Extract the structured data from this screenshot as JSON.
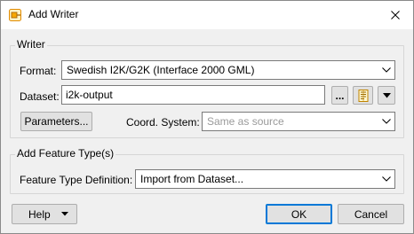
{
  "window": {
    "title": "Add Writer",
    "close_icon": "close-icon"
  },
  "writer_group": {
    "label": "Writer",
    "format_label": "Format:",
    "format_value": "Swedish I2K/G2K (Interface 2000 GML)",
    "dataset_label": "Dataset:",
    "dataset_value": "i2k-output",
    "browse_label": "...",
    "parameters_label": "Parameters...",
    "coord_label": "Coord. System:",
    "coord_placeholder": "Same as source"
  },
  "feature_group": {
    "label": "Add Feature Type(s)",
    "definition_label": "Feature Type Definition:",
    "definition_value": "Import from Dataset..."
  },
  "footer": {
    "help_label": "Help",
    "ok_label": "OK",
    "cancel_label": "Cancel"
  },
  "colors": {
    "accent": "#0078d7",
    "border": "#7a7a7a",
    "button_face": "#e1e1e1"
  }
}
